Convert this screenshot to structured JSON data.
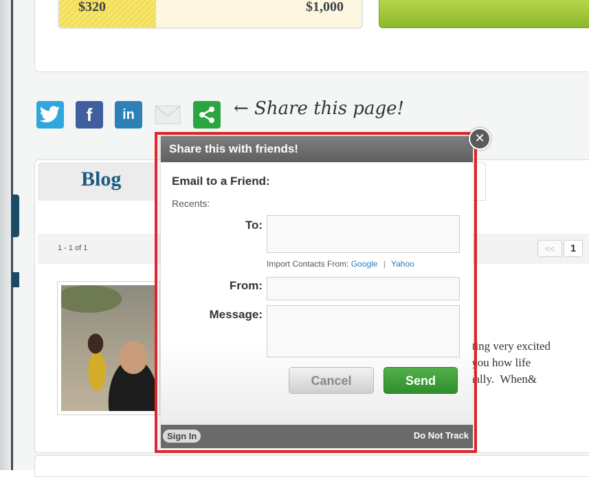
{
  "campaign": {
    "raised": "$320",
    "goal": "$1,000",
    "progress_fraction": 0.32
  },
  "share_bar": {
    "label": "← Share this page!",
    "icons": [
      {
        "name": "twitter-icon",
        "glyph": "t",
        "color": "#2fa6dc"
      },
      {
        "name": "facebook-icon",
        "glyph": "f",
        "color": "#3f5f9f"
      },
      {
        "name": "linkedin-icon",
        "glyph": "in",
        "color": "#2e80b8"
      },
      {
        "name": "email-icon",
        "glyph": "",
        "color": "#e8eaea"
      },
      {
        "name": "share-icon",
        "glyph": "",
        "color": "#2aa53f"
      }
    ]
  },
  "blog": {
    "title": "Blog",
    "pager_count": "1 - 1 of 1",
    "pager_prev": "<<",
    "pager_page": "1",
    "post_excerpt": "tting very excited\n you how life\nnally.  When&"
  },
  "modal": {
    "header": "Share this with friends!",
    "close_glyph": "✕",
    "section_title": "Email to a Friend:",
    "recents_label": "Recents:",
    "to_label": "To:",
    "to_value": "",
    "import_label": "Import Contacts From:",
    "import_google": "Google",
    "import_separator": "|",
    "import_yahoo": "Yahoo",
    "from_label": "From:",
    "from_value": "",
    "message_label": "Message:",
    "message_value": "",
    "cancel_label": "Cancel",
    "send_label": "Send",
    "sign_in_label": "Sign In",
    "do_not_track_label": "Do Not Track"
  }
}
